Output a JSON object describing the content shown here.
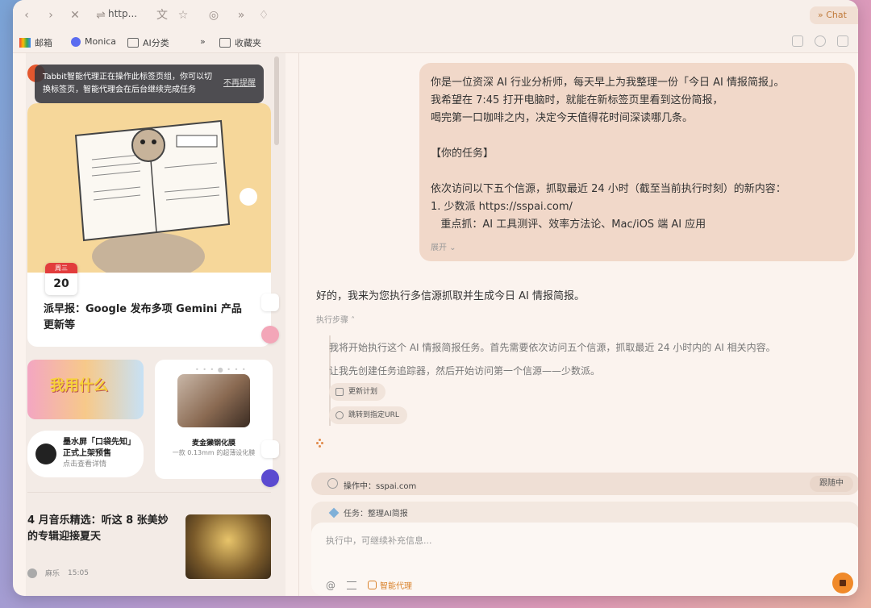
{
  "toolbar": {
    "url": "http...",
    "chat_tab": "» Chat"
  },
  "bookmarks": {
    "items": [
      "邮箱",
      "Monica",
      "AI分类",
      "收藏夹"
    ],
    "overflow": "»"
  },
  "left_pane": {
    "tooltip": {
      "text": "Tabbit智能代理正在操作此标签页组，你可以切换标签页，智能代理会在后台继续完成任务",
      "dismiss": "不再提醒"
    },
    "card1": {
      "weekday": "周三",
      "day": "20",
      "title": "派早报：Google 发布多项 Gemini 产品更新等"
    },
    "card2": {
      "image_text": "我用什么",
      "title": "墨水屏「口袋先知」正式上架预售",
      "subtitle": "点击查看详情"
    },
    "card3": {
      "title": "麦金獭钢化膜",
      "subtitle": "一款 0.13mm 的超薄设化膜"
    },
    "card4": {
      "title": "4 月音乐精选：听这 8 张美妙的专辑迎接夏天",
      "author": "麻乐",
      "time": "15:05"
    }
  },
  "chat": {
    "user_message": {
      "lines": [
        "你是一位资深 AI 行业分析师，每天早上为我整理一份「今日 AI 情报简报」。",
        "我希望在 7:45 打开电脑时，就能在新标签页里看到这份简报，",
        "喝完第一口咖啡之内，决定今天值得花时间深读哪几条。",
        "",
        "【你的任务】",
        "",
        "依次访问以下五个信源，抓取最近 24 小时（截至当前执行时刻）的新内容：",
        "1. 少数派 https://sspai.com/",
        "   重点抓：AI 工具测评、效率方法论、Mac/iOS 端 AI 应用"
      ],
      "expand": "展开"
    },
    "ai_reply": "好的，我来为您执行多信源抓取并生成今日 AI 情报简报。",
    "steps_label": "执行步骤",
    "steps": [
      "我将开始执行这个 AI 情报简报任务。首先需要依次访问五个信源，抓取最近 24 小时内的 AI 相关内容。",
      "让我先创建任务追踪器，然后开始访问第一个信源——少数派。"
    ],
    "chips": [
      "更新计划",
      "跳转到指定URL"
    ]
  },
  "status": {
    "operating": "操作中：sspai.com",
    "follow": "跟随中"
  },
  "input": {
    "task": "任务：整理AI简报",
    "placeholder": "执行中，可继续补充信息...",
    "agent_label": "智能代理"
  },
  "colors": {
    "accent": "#f08a2a",
    "user_bubble": "#f1d8c9",
    "window_bg": "#fbf3ee"
  }
}
